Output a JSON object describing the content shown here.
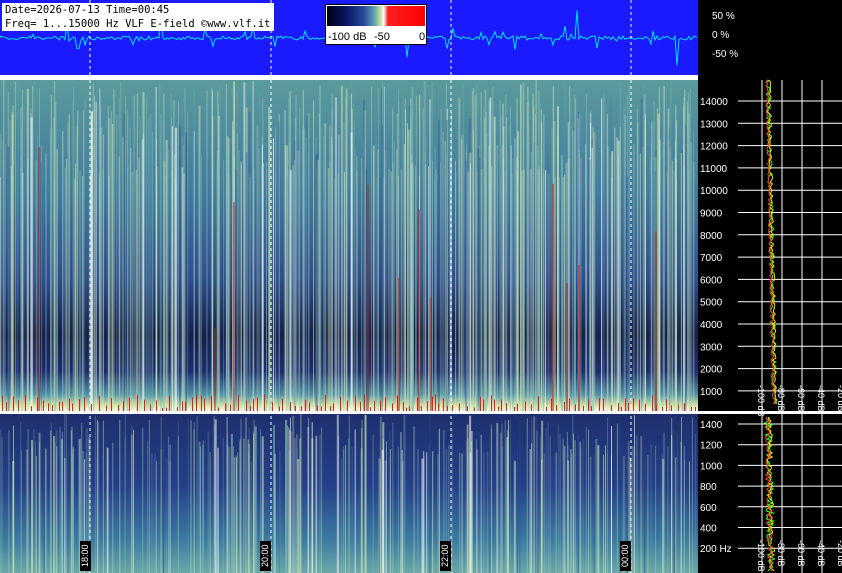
{
  "header": {
    "date_line": "Date=2026-07-13 Time=00:45",
    "freq_line": "Freq= 1...15000 Hz   VLF E-field ©www.vlf.it"
  },
  "scale": {
    "label_min": "-100 dB",
    "label_mid": "-50",
    "label_max": "0"
  },
  "waveform_axis": {
    "labels": [
      "50 %",
      "0 %",
      "-50 %"
    ]
  },
  "upper_spectrogram": {
    "freq_labels": [
      "14000",
      "13000",
      "12000",
      "11000",
      "10000",
      "9000",
      "8000",
      "7000",
      "6000",
      "5000",
      "4000",
      "3000",
      "2000",
      "1000"
    ],
    "db_labels": [
      "-100 dB",
      "-80 dB",
      "-60 dB",
      "-40 dB",
      "-20 dB"
    ]
  },
  "lower_spectrogram": {
    "freq_labels": [
      "1400",
      "1200",
      "1000",
      "800",
      "600",
      "400",
      "200 Hz"
    ],
    "db_labels": [
      "-100 dB",
      "-80 dB",
      "-60 dB",
      "-40 dB",
      "-20 dB"
    ]
  },
  "time_labels": [
    "18:00",
    "20:00",
    "22:00",
    "00:00"
  ],
  "colors": {
    "waveform_bg": "#1a1aff",
    "waveform_trace": "#00e0e0",
    "spectrogram_base": "#1a2a66",
    "axis_bg": "#000000",
    "profile_red": "#ff3030",
    "profile_yellow": "#e8e800",
    "profile_green": "#30ff30"
  }
}
